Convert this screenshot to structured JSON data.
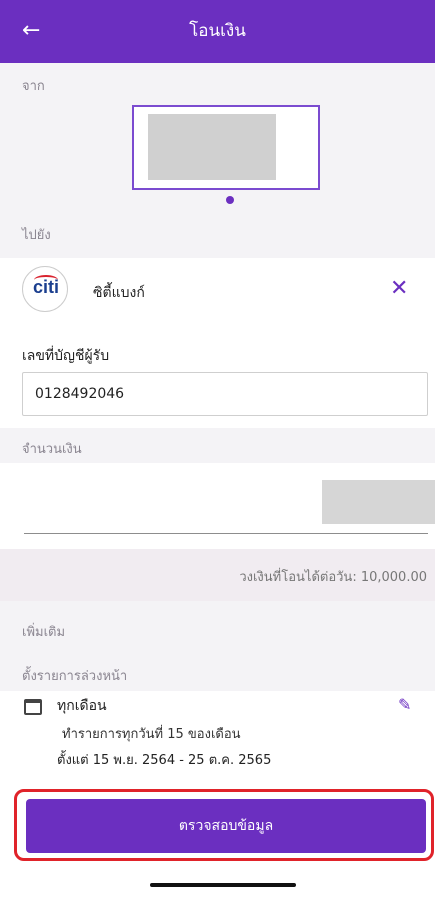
{
  "header": {
    "title": "โอนเงิน",
    "back_icon": "arrow-left-icon"
  },
  "from": {
    "label": "จาก"
  },
  "to": {
    "label": "ไปยัง"
  },
  "bank": {
    "logo_text": "citi",
    "name": "ซิตี้แบงก์",
    "close_icon": "close-icon"
  },
  "account": {
    "label": "เลขที่บัญชีผู้รับ",
    "value": "0128492046"
  },
  "amount": {
    "label": "จำนวนเงิน"
  },
  "limit": {
    "text": "วงเงินที่โอนได้ต่อวัน: 10,000.00"
  },
  "more": {
    "label": "เพิ่มเติม"
  },
  "schedule": {
    "label": "ตั้งรายการล่วงหน้า",
    "frequency": "ทุกเดือน",
    "description": "ทำรายการทุกวันที่ 15 ของเดือน",
    "range": "ตั้งแต่ 15 พ.ย. 2564 - 25 ต.ค. 2565"
  },
  "submit": {
    "label": "ตรวจสอบข้อมูล"
  },
  "colors": {
    "primary": "#6b2fc0",
    "highlight": "#e0232a"
  }
}
